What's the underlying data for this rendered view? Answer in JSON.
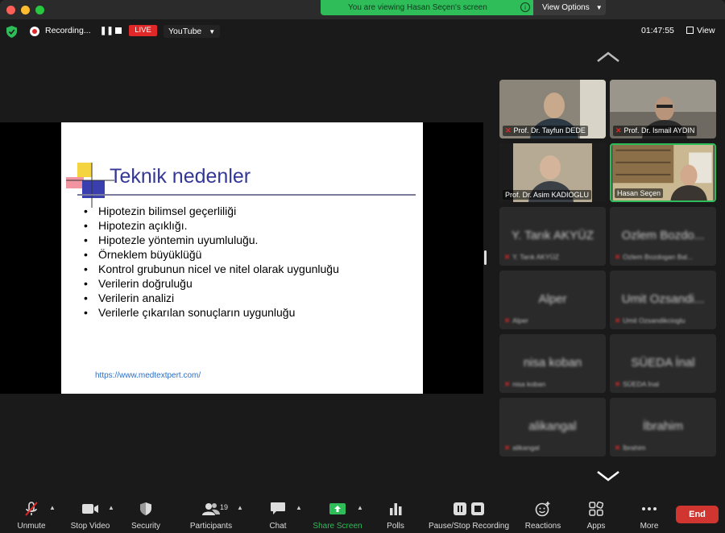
{
  "banner": {
    "viewing_text": "You are viewing Hasan Seçen's screen",
    "view_options": "View Options"
  },
  "status": {
    "recording": "Recording...",
    "live": "LIVE",
    "stream_target": "YouTube",
    "clock": "01:47:55",
    "view": "View"
  },
  "slide": {
    "title": "Teknik nedenler",
    "bullets": [
      "Hipotezin bilimsel geçerliliği",
      "Hipotezin açıklığı.",
      "Hipotezle yöntemin uyumluluğu.",
      "Örneklem büyüklüğü",
      "Kontrol grubunun nicel ve nitel olarak uygunluğu",
      "Verilerin doğruluğu",
      "Verilerin  analizi",
      "Verilerle çıkarılan sonuçların uygunluğu"
    ],
    "url": "https://www.medtextpert.com/"
  },
  "participants": [
    {
      "name": "Prof. Dr. Tayfun DEDE",
      "muted": true
    },
    {
      "name": "Prof. Dr. Ismail AYDIN",
      "muted": true
    },
    {
      "name": "Prof. Dr. Asim KADIOGLU",
      "muted": false
    },
    {
      "name": "Hasan Seçen",
      "muted": false
    },
    {
      "name": "Y. Tarık AKYÜZ",
      "muted": true
    },
    {
      "name": "Ozlem Bozdo...",
      "muted": true
    },
    {
      "name": "Alper",
      "muted": true
    },
    {
      "name": "Umit Ozsandi...",
      "muted": true
    },
    {
      "name": "nisa koban",
      "muted": true
    },
    {
      "name": "SÜEDA İnal",
      "muted": true
    },
    {
      "name": "alikangal",
      "muted": true
    },
    {
      "name": "İbrahim",
      "muted": true
    }
  ],
  "participants_small": [
    "Y. Tarık AKYÜZ",
    "Ozlem Bozdogan Bal...",
    "Alper",
    "Umit Ozsandikcioglu",
    "nisa koban",
    "SÜEDA İnal",
    "alikangal",
    "İbrahim"
  ],
  "toolbar": {
    "unmute": "Unmute",
    "stop_video": "Stop Video",
    "security": "Security",
    "participants": "Participants",
    "participants_count": "19",
    "chat": "Chat",
    "share_screen": "Share Screen",
    "polls": "Polls",
    "pause_stop_recording": "Pause/Stop Recording",
    "reactions": "Reactions",
    "apps": "Apps",
    "more": "More",
    "end": "End"
  },
  "colors": {
    "accent_green": "#2ebd59",
    "end_red": "#d0352f",
    "live_red": "#e02828",
    "slide_title": "#343795"
  },
  "icons": [
    "shield-icon",
    "record-icon",
    "pause-icon",
    "stop-icon",
    "grid-icon",
    "mic-muted-icon",
    "video-icon",
    "security-icon",
    "participants-icon",
    "chat-icon",
    "share-screen-icon",
    "polls-icon",
    "reactions-icon",
    "apps-icon",
    "more-icon",
    "chevron-up-icon",
    "chevron-down-icon"
  ]
}
